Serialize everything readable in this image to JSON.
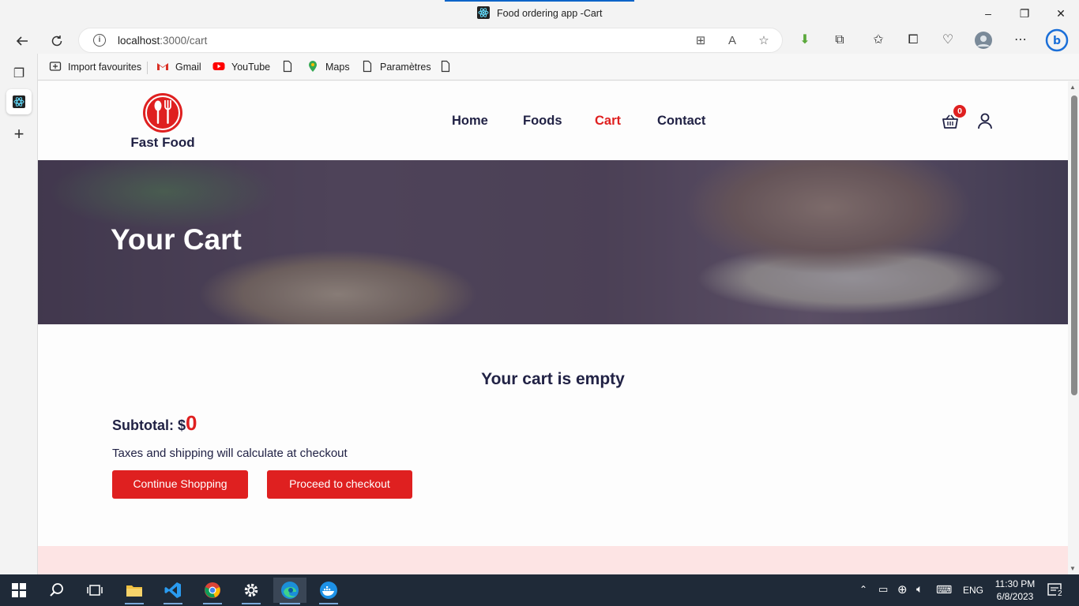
{
  "window": {
    "title": "Food ordering app -Cart",
    "controls": {
      "minimize": "–",
      "maximize": "❐",
      "close": "✕"
    }
  },
  "browser": {
    "url_host": "localhost",
    "url_path": ":3000/cart",
    "bookmarks": [
      {
        "label": "Import favourites",
        "icon": "import-icon"
      },
      {
        "label": "Gmail",
        "icon": "gmail-icon"
      },
      {
        "label": "YouTube",
        "icon": "youtube-icon"
      },
      {
        "label": "",
        "icon": "page-icon"
      },
      {
        "label": "Maps",
        "icon": "maps-icon"
      },
      {
        "label": "Paramètres",
        "icon": "page-icon"
      },
      {
        "label": "",
        "icon": "page-icon"
      }
    ]
  },
  "site": {
    "brand": "Fast Food",
    "menu": [
      "Home",
      "Foods",
      "Cart",
      "Contact"
    ],
    "active_menu": "Cart",
    "cart_count": "0",
    "accent_color": "#df2020",
    "dark_color": "#212245"
  },
  "hero": {
    "title": "Your Cart"
  },
  "cart": {
    "empty_message": "Your cart is empty",
    "subtotal_label": "Subtotal: $",
    "subtotal_value": "0",
    "taxes_note": "Taxes and shipping will calculate at checkout",
    "continue_label": "Continue Shopping",
    "checkout_label": "Proceed to checkout"
  },
  "taskbar": {
    "language": "ENG",
    "time": "11:30 PM",
    "date": "6/8/2023",
    "notifications": "2"
  }
}
